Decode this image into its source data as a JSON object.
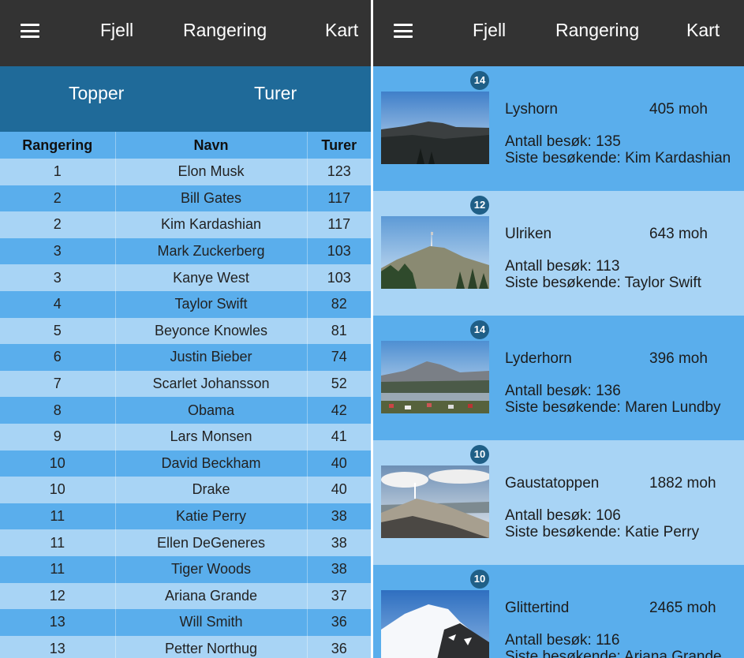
{
  "left": {
    "nav": {
      "fjell": "Fjell",
      "rangering": "Rangering",
      "kart": "Kart"
    },
    "tabs": {
      "topper": "Topper",
      "turer": "Turer"
    },
    "table": {
      "headers": [
        "Rangering",
        "Navn",
        "Turer"
      ],
      "rows": [
        [
          "1",
          "Elon Musk",
          "123"
        ],
        [
          "2",
          "Bill Gates",
          "117"
        ],
        [
          "2",
          "Kim Kardashian",
          "117"
        ],
        [
          "3",
          "Mark Zuckerberg",
          "103"
        ],
        [
          "3",
          "Kanye West",
          "103"
        ],
        [
          "4",
          "Taylor Swift",
          "82"
        ],
        [
          "5",
          "Beyonce Knowles",
          "81"
        ],
        [
          "6",
          "Justin Bieber",
          "74"
        ],
        [
          "7",
          "Scarlet Johansson",
          "52"
        ],
        [
          "8",
          "Obama",
          "42"
        ],
        [
          "9",
          "Lars Monsen",
          "41"
        ],
        [
          "10",
          "David Beckham",
          "40"
        ],
        [
          "10",
          "Drake",
          "40"
        ],
        [
          "11",
          "Katie Perry",
          "38"
        ],
        [
          "11",
          "Ellen DeGeneres",
          "38"
        ],
        [
          "11",
          "Tiger Woods",
          "38"
        ],
        [
          "12",
          "Ariana Grande",
          "37"
        ],
        [
          "13",
          "Will Smith",
          "36"
        ],
        [
          "13",
          "Petter Northug",
          "36"
        ]
      ]
    }
  },
  "right": {
    "nav": {
      "fjell": "Fjell",
      "rangering": "Rangering",
      "kart": "Kart"
    },
    "cards": [
      {
        "badge": "14",
        "name": "Lyshorn",
        "height": "405 moh",
        "visits": "Antall besøk: 135",
        "last": "Siste besøkende: Kim Kardashian"
      },
      {
        "badge": "12",
        "name": "Ulriken",
        "height": "643 moh",
        "visits": "Antall besøk: 113",
        "last": "Siste besøkende: Taylor Swift"
      },
      {
        "badge": "14",
        "name": "Lyderhorn",
        "height": "396 moh",
        "visits": "Antall besøk: 136",
        "last": "Siste besøkende: Maren Lundby"
      },
      {
        "badge": "10",
        "name": "Gaustatoppen",
        "height": "1882 moh",
        "visits": "Antall besøk: 106",
        "last": "Siste besøkende: Katie Perry"
      },
      {
        "badge": "10",
        "name": "Glittertind",
        "height": "2465 moh",
        "visits": "Antall besøk: 116",
        "last": "Siste besøkende: Ariana Grande"
      }
    ]
  },
  "colors": {
    "navbar": "#333333",
    "subnav": "#1f6a99",
    "row_light": "#a8d4f5",
    "row_dark": "#5aaeec",
    "badge": "#1f5f87"
  }
}
